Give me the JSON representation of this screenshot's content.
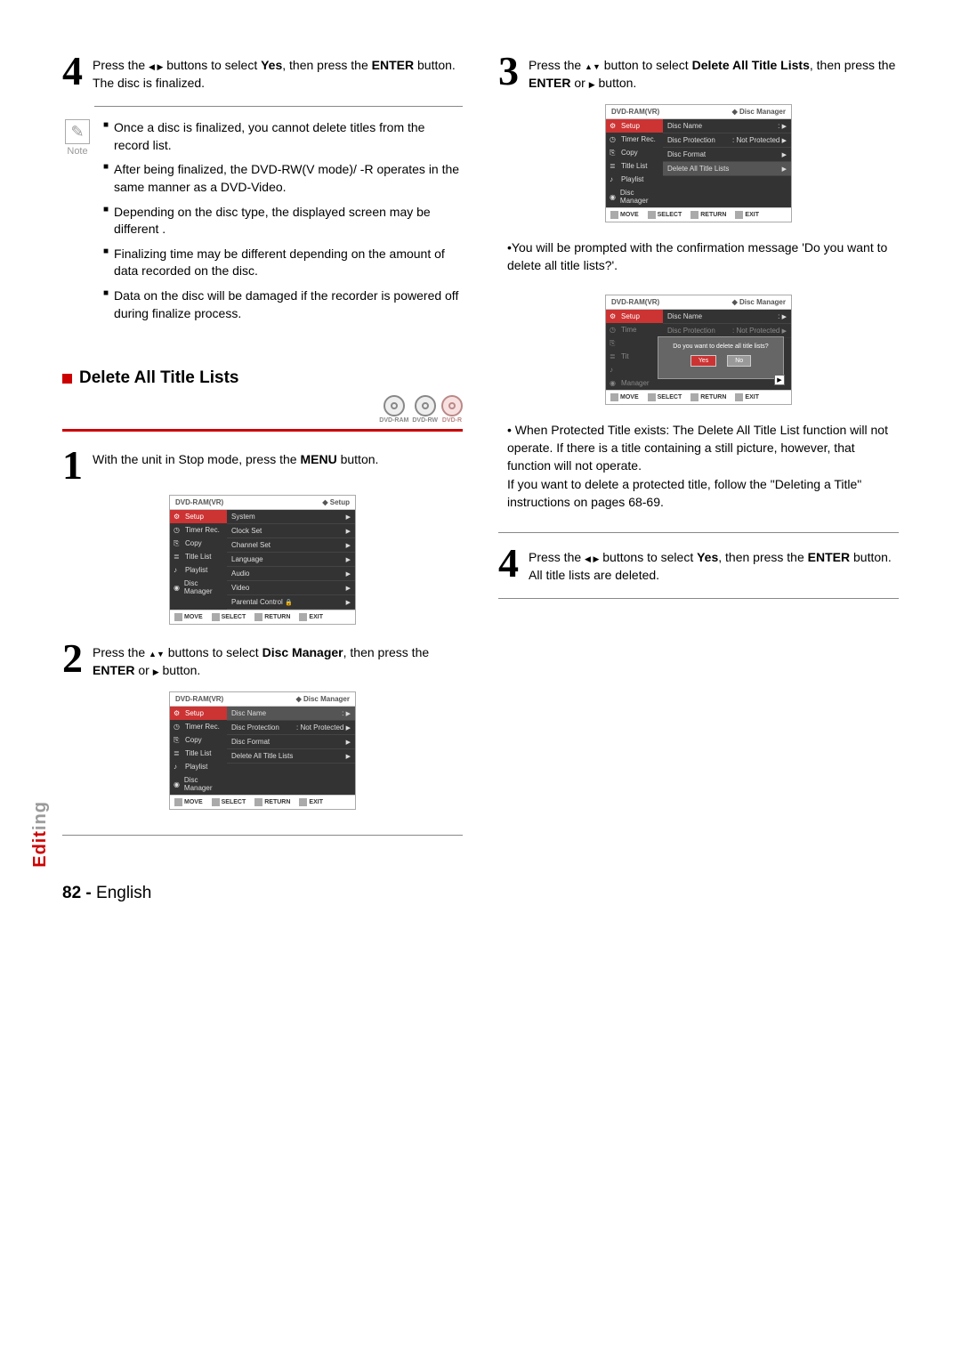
{
  "left": {
    "step4": {
      "num": "4",
      "t1": "Press the ",
      "t2": " buttons to select ",
      "yes": "Yes",
      "t3": ", then press the ",
      "enter": "ENTER",
      "t4": " button.",
      "t5": "The disc is finalized."
    },
    "note_label": "Note",
    "notes": [
      "Once a disc is finalized, you cannot delete titles from the record list.",
      "After being finalized, the DVD-RW(V mode)/ -R operates in the same manner as a DVD-Video.",
      "Depending on the disc type, the displayed screen may be different .",
      "Finalizing time may be different depending on the amount of data recorded on the disc.",
      "Data on the disc will be damaged if the recorder is powered off during finalize process."
    ],
    "section_title": "Delete All Title Lists",
    "discs": [
      "DVD-RAM",
      "DVD-RW",
      "DVD-R"
    ],
    "step1": {
      "num": "1",
      "t1": "With the unit in Stop mode, press the ",
      "menu": "MENU",
      "t2": " button."
    },
    "osd1": {
      "hdr_left": "DVD-RAM(VR)",
      "hdr_right": "Setup",
      "side": [
        "Setup",
        "Timer Rec.",
        "Copy",
        "Title List",
        "Playlist",
        "Disc Manager"
      ],
      "main": [
        "System",
        "Clock Set",
        "Channel Set",
        "Language",
        "Audio",
        "Video",
        "Parental Control"
      ],
      "ftr": [
        "MOVE",
        "SELECT",
        "RETURN",
        "EXIT"
      ]
    },
    "step2": {
      "num": "2",
      "t1": "Press the ",
      "t2": " buttons to select ",
      "dm": "Disc Manager",
      "t3": ", then press the ",
      "enter": "ENTER",
      "t4": " or ",
      "t5": " button."
    },
    "osd2": {
      "hdr_left": "DVD-RAM(VR)",
      "hdr_right": "Disc Manager",
      "side": [
        "Setup",
        "Timer Rec.",
        "Copy",
        "Title List",
        "Playlist",
        "Disc Manager"
      ],
      "rows": [
        {
          "l": "Disc Name",
          "r": ":"
        },
        {
          "l": "Disc Protection",
          "r": ": Not Protected"
        },
        {
          "l": "Disc Format",
          "r": ""
        },
        {
          "l": "Delete All Title Lists",
          "r": ""
        }
      ]
    }
  },
  "right": {
    "step3": {
      "num": "3",
      "t1": "Press the ",
      "t2": " button to select ",
      "dat": "Delete All Title Lists",
      "t3": ", then press the ",
      "enter": "ENTER",
      "t4": " or ",
      "t5": " button."
    },
    "osd3": {
      "hdr_left": "DVD-RAM(VR)",
      "hdr_right": "Disc Manager",
      "side": [
        "Setup",
        "Timer Rec.",
        "Copy",
        "Title List",
        "Playlist",
        "Disc Manager"
      ],
      "rows": [
        {
          "l": "Disc Name",
          "r": ":"
        },
        {
          "l": "Disc Protection",
          "r": ": Not Protected"
        },
        {
          "l": "Disc Format",
          "r": ""
        },
        {
          "l": "Delete All Title Lists",
          "r": ""
        }
      ]
    },
    "bullet1": "You will be prompted with the confirmation message 'Do you want to delete all title lists?'.",
    "osd4": {
      "hdr_left": "DVD-RAM(VR)",
      "hdr_right": "Disc Manager",
      "dlg_q": "Do you want to delete all title lists?",
      "yes": "Yes",
      "no": "No",
      "row_top_l": "Disc Name",
      "row_top_r": ":",
      "row2_l": "Disc Protection",
      "row2_r": ": Not Protected",
      "side_dim": [
        "Setup",
        "Timer Rec.",
        "Copy",
        "Title List",
        "Playlist",
        "Disc Manager"
      ]
    },
    "bullet2a": "When Protected Title exists: The Delete All Title List function will not operate. If there is a title containing a still picture, however, that function will not operate.",
    "bullet2b": "If you want to delete a protected title, follow the \"Deleting a Title\" instructions on pages 68-69.",
    "step4": {
      "num": "4",
      "t1": "Press the ",
      "t2": " buttons to select ",
      "yes": "Yes",
      "t3": ", then press the ",
      "enter": "ENTER",
      "t4": " button.",
      "t5": "All title lists are deleted."
    }
  },
  "ftr_move": "MOVE",
  "ftr_select": "SELECT",
  "ftr_return": "RETURN",
  "ftr_exit": "EXIT",
  "side_tab_1": "Edit",
  "side_tab_2": "ing",
  "page_num": "82 -",
  "page_lang": "English"
}
